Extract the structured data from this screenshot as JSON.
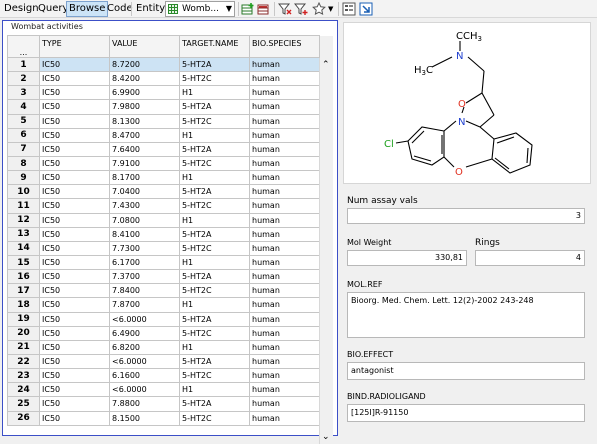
{
  "toolbar": {
    "design": "Design",
    "query": "Query",
    "browse": "Browse",
    "code": "Code",
    "entity_label": "Entity:",
    "entity_value": "Womb..."
  },
  "grid": {
    "title": "Wombat activities",
    "corner": "...",
    "columns": [
      "TYPE",
      "VALUE",
      "TARGET.NAME",
      "BIO.SPECIES"
    ],
    "rows": [
      [
        "1",
        "IC50",
        "8.7200",
        "5-HT2A",
        "human"
      ],
      [
        "2",
        "IC50",
        "8.4200",
        "5-HT2C",
        "human"
      ],
      [
        "3",
        "IC50",
        "6.9900",
        "H1",
        "human"
      ],
      [
        "4",
        "IC50",
        "7.9800",
        "5-HT2A",
        "human"
      ],
      [
        "5",
        "IC50",
        "8.1300",
        "5-HT2C",
        "human"
      ],
      [
        "6",
        "IC50",
        "8.4700",
        "H1",
        "human"
      ],
      [
        "7",
        "IC50",
        "7.6400",
        "5-HT2A",
        "human"
      ],
      [
        "8",
        "IC50",
        "7.9100",
        "5-HT2C",
        "human"
      ],
      [
        "9",
        "IC50",
        "8.1700",
        "H1",
        "human"
      ],
      [
        "10",
        "IC50",
        "7.0400",
        "5-HT2A",
        "human"
      ],
      [
        "11",
        "IC50",
        "7.4300",
        "5-HT2C",
        "human"
      ],
      [
        "12",
        "IC50",
        "7.0800",
        "H1",
        "human"
      ],
      [
        "13",
        "IC50",
        "8.4100",
        "5-HT2A",
        "human"
      ],
      [
        "14",
        "IC50",
        "7.7300",
        "5-HT2C",
        "human"
      ],
      [
        "15",
        "IC50",
        "6.1700",
        "H1",
        "human"
      ],
      [
        "16",
        "IC50",
        "7.3700",
        "5-HT2A",
        "human"
      ],
      [
        "17",
        "IC50",
        "7.8400",
        "5-HT2C",
        "human"
      ],
      [
        "18",
        "IC50",
        "7.8700",
        "H1",
        "human"
      ],
      [
        "19",
        "IC50",
        "<6.0000",
        "5-HT2A",
        "human"
      ],
      [
        "20",
        "IC50",
        "6.4900",
        "5-HT2C",
        "human"
      ],
      [
        "21",
        "IC50",
        "6.8200",
        "H1",
        "human"
      ],
      [
        "22",
        "IC50",
        "<6.0000",
        "5-HT2A",
        "human"
      ],
      [
        "23",
        "IC50",
        "6.1600",
        "5-HT2C",
        "human"
      ],
      [
        "24",
        "IC50",
        "<6.0000",
        "H1",
        "human"
      ],
      [
        "25",
        "IC50",
        "7.8800",
        "5-HT2A",
        "human"
      ],
      [
        "26",
        "IC50",
        "8.1500",
        "5-HT2C",
        "human"
      ]
    ]
  },
  "detail": {
    "atoms": {
      "n_top": "N",
      "ch3": "CH",
      "h3c": "H",
      "three_a": "3",
      "three_b": "3",
      "c_label": "C",
      "n_ring": "N",
      "o_ring": "O",
      "o_bottom": "O",
      "cl": "Cl"
    },
    "num_assay_label": "Num assay vals",
    "num_assay_value": "3",
    "mol_weight_label": "Mol Weight",
    "mol_weight_value": "330,81",
    "rings_label": "Rings",
    "rings_value": "4",
    "mol_ref_label": "MOL.REF",
    "mol_ref_value": "Bioorg. Med. Chem. Lett. 12(2)-2002 243-248",
    "bio_effect_label": "BIO.EFFECT",
    "bio_effect_value": "antagonist",
    "bind_label": "BIND.RADIOLIGAND",
    "bind_value": "[125I]R-91150"
  },
  "colors": {
    "accent_border": "#3c4fc7",
    "selected_row": "#cde3f4",
    "cl_green": "#1ca01c",
    "n_blue": "#2040d0",
    "o_red": "#e03020"
  }
}
